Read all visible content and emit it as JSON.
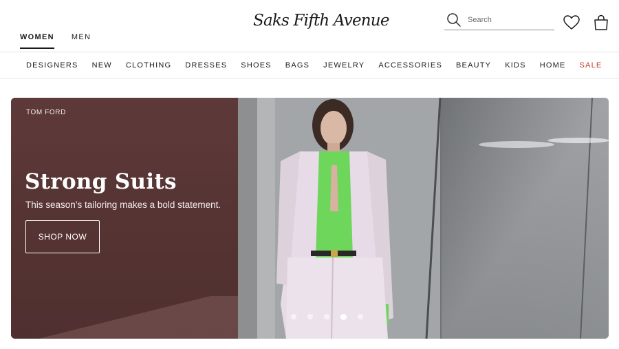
{
  "header": {
    "gender_tabs": [
      {
        "label": "WOMEN",
        "active": true
      },
      {
        "label": "MEN",
        "active": false
      }
    ],
    "logo_text": "Saks Fifth Avenue",
    "search": {
      "placeholder": "Search",
      "value": ""
    },
    "icons": {
      "wishlist": "heart-icon",
      "bag": "shopping-bag-icon",
      "search": "search-icon"
    }
  },
  "nav": {
    "items": [
      {
        "label": "DESIGNERS"
      },
      {
        "label": "NEW"
      },
      {
        "label": "CLOTHING"
      },
      {
        "label": "DRESSES"
      },
      {
        "label": "SHOES"
      },
      {
        "label": "BAGS"
      },
      {
        "label": "JEWELRY"
      },
      {
        "label": "ACCESSORIES"
      },
      {
        "label": "BEAUTY"
      },
      {
        "label": "KIDS"
      },
      {
        "label": "HOME"
      },
      {
        "label": "SALE"
      }
    ],
    "sale_color": "#c0392b"
  },
  "hero": {
    "brand": "TOM FORD",
    "title": "Strong Suits",
    "subtitle": "This season’s tailoring makes a bold statement.",
    "cta": "SHOP NOW",
    "panel_color": "#5b3636",
    "slides_count": 5,
    "active_slide": 4
  }
}
